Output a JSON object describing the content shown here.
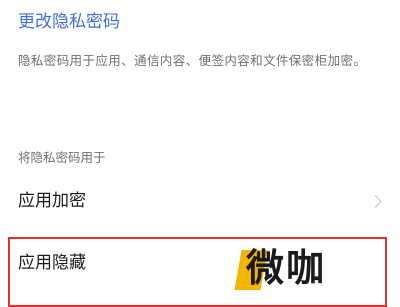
{
  "header": {
    "change_password_link": "更改隐私密码"
  },
  "description": "隐私密码用于应用、通信内容、便签内容和文件保密柜加密。",
  "section": {
    "title": "将隐私密码用于"
  },
  "items": [
    {
      "label": "应用加密",
      "chevron": "chevron-right-icon"
    },
    {
      "label": "应用隐藏"
    }
  ],
  "watermark": {
    "text": "微咖"
  },
  "colors": {
    "link": "#3d6fe0",
    "highlight": "#e03030",
    "watermark_accent": "#f4b400"
  }
}
